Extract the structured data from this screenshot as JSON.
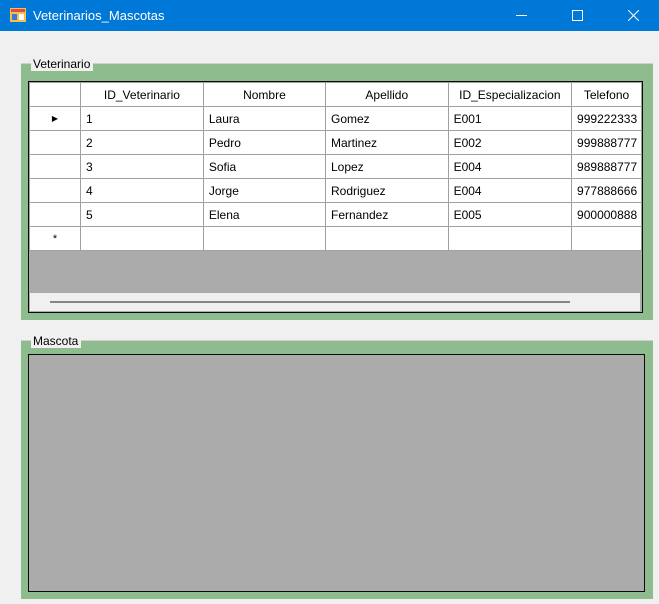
{
  "window": {
    "title": "Veterinarios_Mascotas"
  },
  "veterinario": {
    "legend": "Veterinario",
    "columns": [
      "ID_Veterinario",
      "Nombre",
      "Apellido",
      "ID_Especializacion",
      "Telefono"
    ],
    "rows": [
      [
        "1",
        "Laura",
        "Gomez",
        "E001",
        "999222333"
      ],
      [
        "2",
        "Pedro",
        "Martinez",
        "E002",
        "999888777"
      ],
      [
        "3",
        "Sofia",
        "Lopez",
        "E004",
        "989888777"
      ],
      [
        "4",
        "Jorge",
        "Rodriguez",
        "E004",
        "977888666"
      ],
      [
        "5",
        "Elena",
        "Fernandez",
        "E005",
        "900000888"
      ]
    ],
    "current_row_marker": "▶",
    "new_row_marker": "*"
  },
  "mascota": {
    "legend": "Mascota"
  },
  "colors": {
    "titlebar": "#0078d7",
    "groupbox": "#8fbc8f",
    "grid_background": "#ababab"
  }
}
